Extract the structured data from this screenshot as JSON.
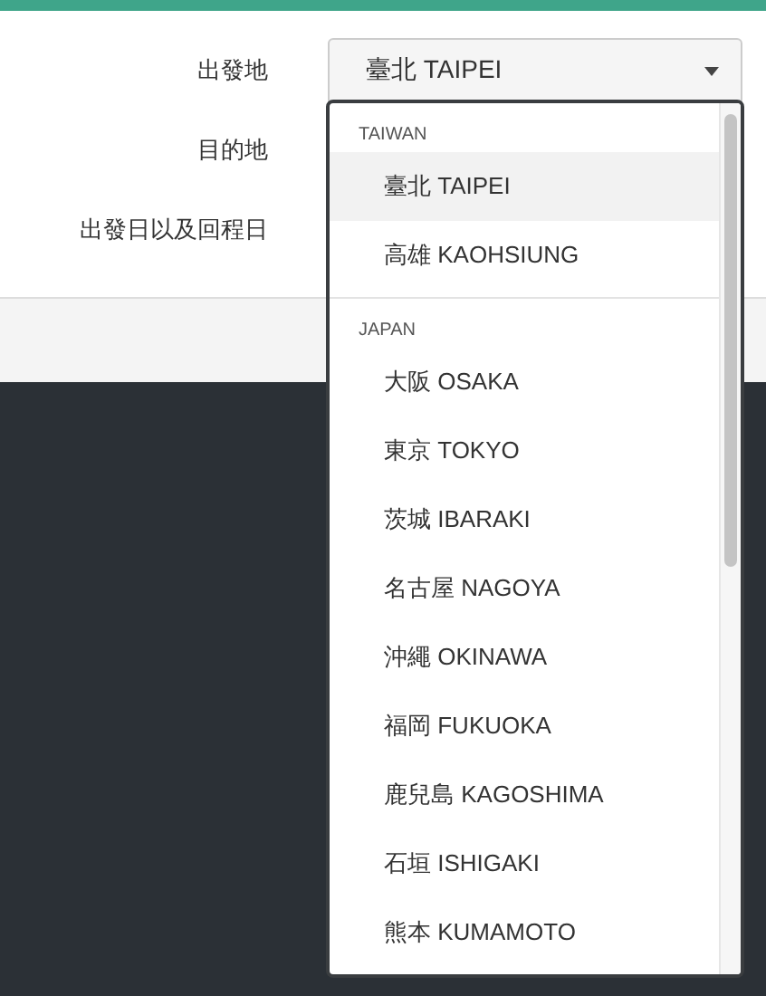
{
  "form": {
    "fields": [
      {
        "label": "出發地",
        "kind": "select",
        "value": "臺北 TAIPEI"
      },
      {
        "label": "目的地",
        "kind": "plain"
      },
      {
        "label": "出發日以及回程日",
        "kind": "plain"
      }
    ]
  },
  "dropdown": {
    "groups": [
      {
        "label": "TAIWAN",
        "options": [
          {
            "label": "臺北 TAIPEI",
            "selected": true
          },
          {
            "label": "高雄 KAOHSIUNG",
            "selected": false
          }
        ]
      },
      {
        "label": "JAPAN",
        "options": [
          {
            "label": "大阪 OSAKA",
            "selected": false
          },
          {
            "label": "東京 TOKYO",
            "selected": false
          },
          {
            "label": "茨城 IBARAKI",
            "selected": false
          },
          {
            "label": "名古屋 NAGOYA",
            "selected": false
          },
          {
            "label": "沖繩 OKINAWA",
            "selected": false
          },
          {
            "label": "福岡 FUKUOKA",
            "selected": false
          },
          {
            "label": "鹿兒島 KAGOSHIMA",
            "selected": false
          },
          {
            "label": "石垣 ISHIGAKI",
            "selected": false
          },
          {
            "label": "熊本 KUMAMOTO",
            "selected": false
          }
        ]
      }
    ]
  }
}
